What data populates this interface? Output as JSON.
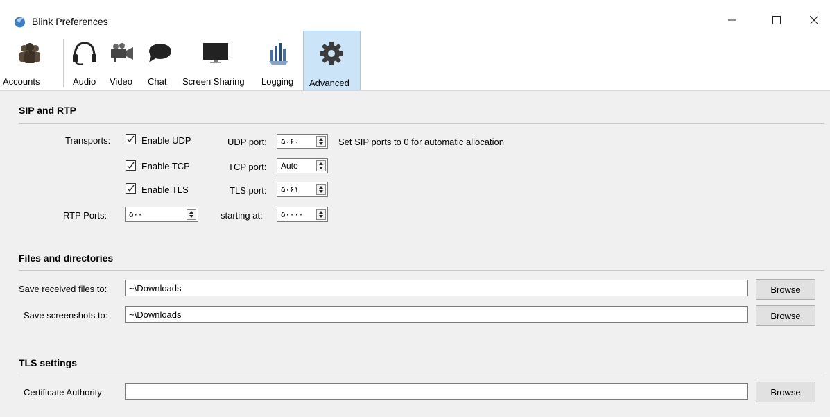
{
  "window": {
    "title": "Blink Preferences"
  },
  "toolbar": {
    "items": [
      {
        "label": "Accounts",
        "icon": "accounts-icon"
      },
      {
        "label": "Audio",
        "icon": "headset-icon"
      },
      {
        "label": "Video",
        "icon": "video-camera-icon"
      },
      {
        "label": "Chat",
        "icon": "chat-bubble-icon"
      },
      {
        "label": "Screen Sharing",
        "icon": "monitor-icon"
      },
      {
        "label": "Logging",
        "icon": "logging-icon"
      },
      {
        "label": "Advanced",
        "icon": "gear-icon",
        "selected": true
      }
    ]
  },
  "sip": {
    "title": "SIP and RTP",
    "transports_label": "Transports:",
    "udp": {
      "check": "Enable UDP",
      "checked": true,
      "port_label": "UDP port:",
      "port_value": "۵۰۶۰"
    },
    "tcp": {
      "check": "Enable TCP",
      "checked": true,
      "port_label": "TCP port:",
      "port_value": "Auto"
    },
    "tls": {
      "check": "Enable TLS",
      "checked": true,
      "port_label": "TLS port:",
      "port_value": "۵۰۶۱"
    },
    "hint": "Set SIP ports to 0 for automatic allocation",
    "rtp_label": "RTP Ports:",
    "rtp_value": "۵۰۰",
    "starting_label": "starting at:",
    "starting_value": "۵۰۰۰۰"
  },
  "files": {
    "title": "Files and directories",
    "received_label": "Save received files to:",
    "received_value": "~\\Downloads",
    "screenshots_label": "Save screenshots to:",
    "screenshots_value": "~\\Downloads",
    "browse": "Browse"
  },
  "tls": {
    "title": "TLS settings",
    "ca_label": "Certificate Authority:",
    "ca_value": "",
    "browse": "Browse"
  }
}
